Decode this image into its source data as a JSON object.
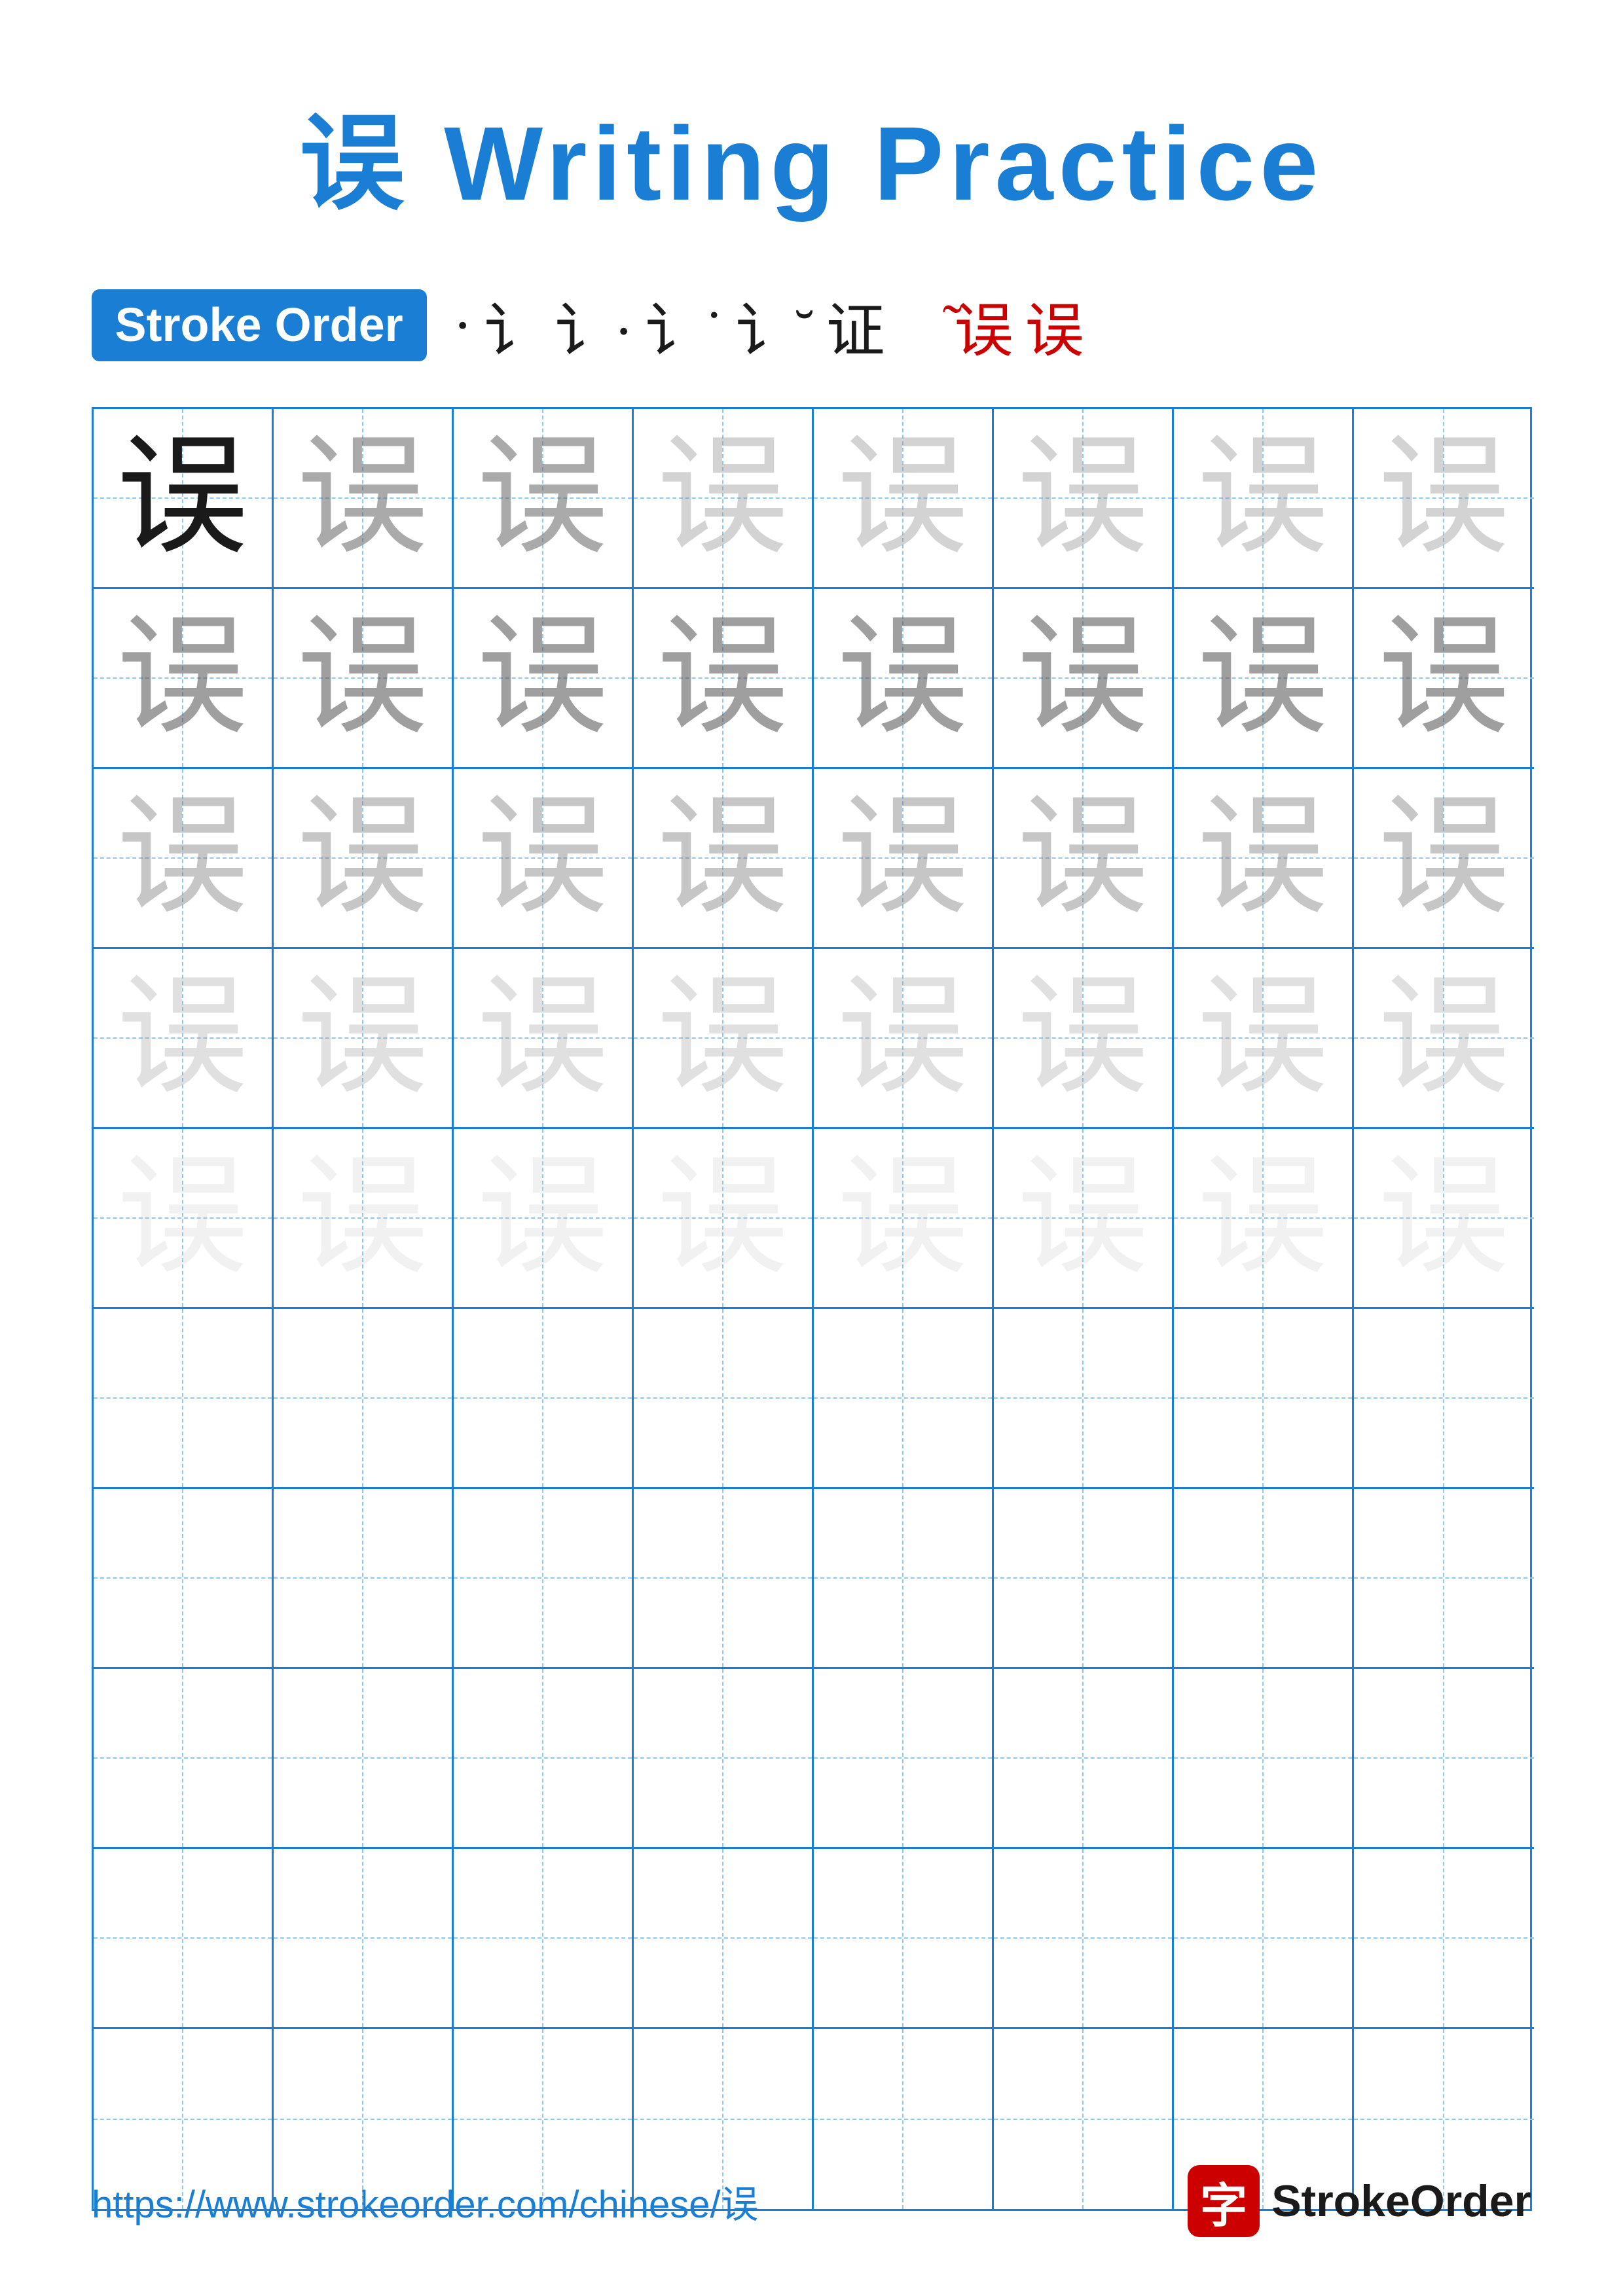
{
  "title": "误 Writing Practice",
  "stroke_order": {
    "badge": "Stroke Order",
    "sequence": [
      "·",
      "i",
      "i·",
      "i˙",
      "i˘",
      "iǒ",
      "误̈",
      "误̇",
      "误"
    ]
  },
  "character": "误",
  "grid": {
    "cols": 8,
    "practice_rows": 5,
    "empty_rows": 5
  },
  "footer": {
    "url": "https://www.strokeorder.com/chinese/误",
    "logo_char": "字",
    "logo_text": "StrokeOrder"
  }
}
